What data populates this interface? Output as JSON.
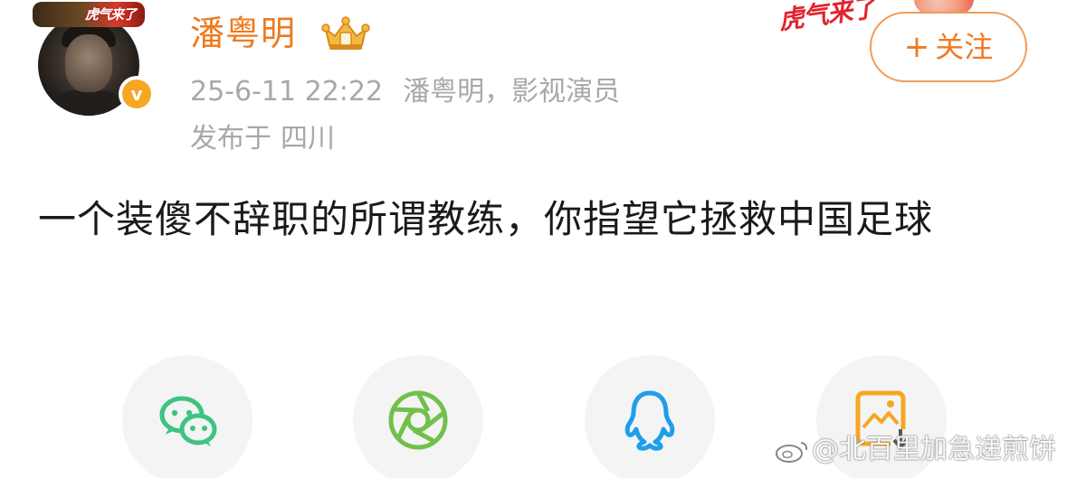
{
  "user": {
    "name": "潘粤明",
    "avatar_frame_text": "虎气来了",
    "verified_mark": "v"
  },
  "post": {
    "timestamp": "25-6-11 22:22",
    "source": "潘粤明，影视演员",
    "location_prefix": "发布于",
    "location": "四川",
    "text": "一个装傻不辞职的所谓教练，你指望它拯救中国足球"
  },
  "follow": {
    "plus": "+",
    "label": "关注"
  },
  "decoration": {
    "text": "虎气来了"
  },
  "share": {
    "items": [
      {
        "icon": "wechat-icon"
      },
      {
        "icon": "moments-icon"
      },
      {
        "icon": "qq-icon"
      },
      {
        "icon": "save-image-icon"
      }
    ]
  },
  "watermark": {
    "text": "@北百里加急递煎饼"
  },
  "colors": {
    "accent": "#ee7a1e",
    "meta": "#a8a8a8",
    "wechat": "#3cc480",
    "moments": "#6fc14a",
    "qq": "#1e9fe8",
    "save": "#f5a623"
  }
}
